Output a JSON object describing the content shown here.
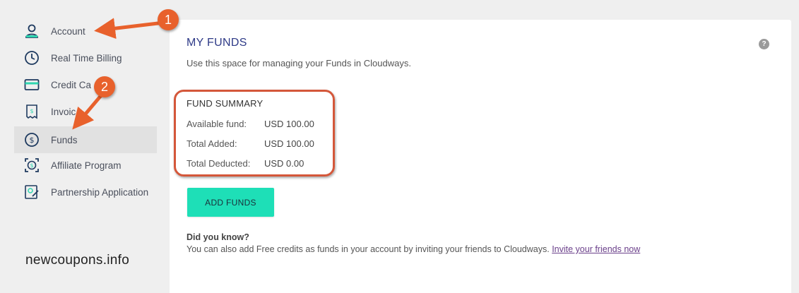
{
  "sidebar": {
    "items": [
      {
        "label": "Account",
        "icon": "user-icon"
      },
      {
        "label": "Real Time Billing",
        "icon": "clock-icon"
      },
      {
        "label": "Credit Ca",
        "icon": "credit-card-icon"
      },
      {
        "label": "Invoic",
        "icon": "invoice-icon"
      },
      {
        "label": "Funds",
        "icon": "dollar-circle-icon",
        "active": true
      },
      {
        "label": "Affiliate Program",
        "icon": "affiliate-icon"
      },
      {
        "label": "Partnership Application",
        "icon": "partnership-icon"
      }
    ]
  },
  "watermark": "newcoupons.info",
  "main": {
    "title": "MY FUNDS",
    "subtitle": "Use this space for managing your Funds in Cloudways.",
    "help_icon": "?",
    "summary": {
      "title": "FUND SUMMARY",
      "rows": [
        {
          "label": "Available fund:",
          "value": "USD 100.00"
        },
        {
          "label": "Total Added:",
          "value": "USD 100.00"
        },
        {
          "label": "Total Deducted:",
          "value": "USD 0.00"
        }
      ]
    },
    "add_button": "ADD FUNDS",
    "did_you_know": {
      "title": "Did you know?",
      "text": "You can also add Free credits as funds in your account by inviting your friends to Cloudways. ",
      "link": "Invite your friends now"
    }
  },
  "annotations": {
    "badge1": "1",
    "badge2": "2"
  },
  "colors": {
    "accent": "#1edfb7",
    "title": "#2e3a87",
    "annotation": "#e8612c",
    "highlight_box": "#d4573a"
  }
}
